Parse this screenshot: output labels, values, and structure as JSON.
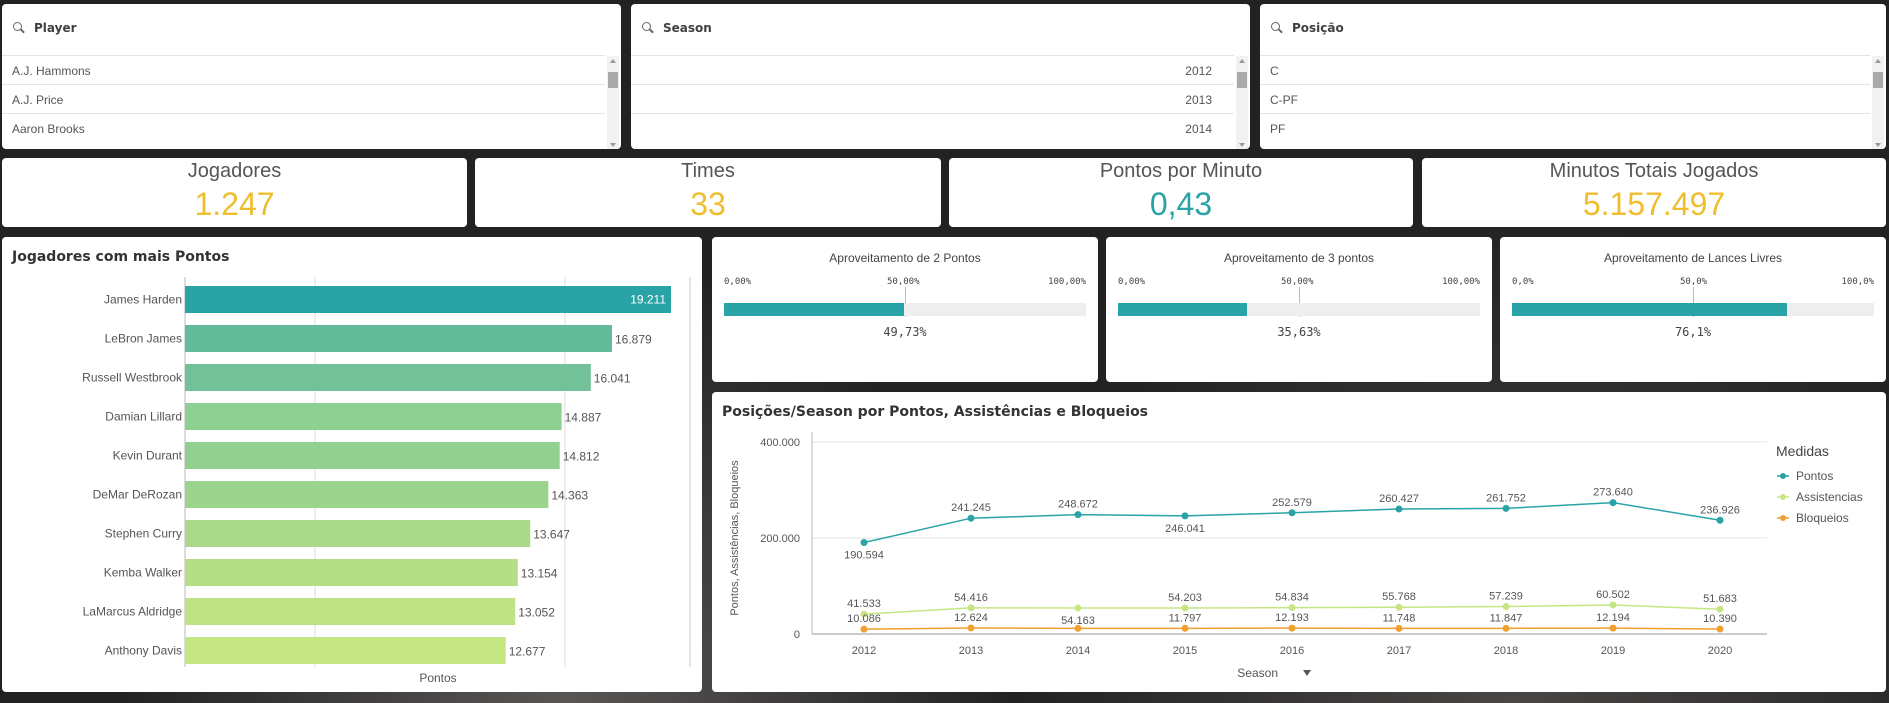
{
  "filters": [
    {
      "title": "Player",
      "items": [
        "A.J. Hammons",
        "A.J. Price",
        "Aaron Brooks"
      ],
      "align": "left"
    },
    {
      "title": "Season",
      "items": [
        "2012",
        "2013",
        "2014"
      ],
      "align": "right"
    },
    {
      "title": "Posição",
      "items": [
        "C",
        "C-PF",
        "PF"
      ],
      "align": "left"
    }
  ],
  "kpis": [
    {
      "label": "Jogadores",
      "value": "1.247",
      "color": "#f0be2d"
    },
    {
      "label": "Times",
      "value": "33",
      "color": "#f0be2d"
    },
    {
      "label": "Pontos por Minuto",
      "value": "0,43",
      "color": "#2aa3a6"
    },
    {
      "label": "Minutos Totais Jogados",
      "value": "5.157.497",
      "color": "#f0be2d"
    }
  ],
  "gauges": [
    {
      "title": "Aproveitamento de 2 Pontos",
      "ticks": [
        "0,00%",
        "50,00%",
        "100,00%"
      ],
      "fraction": 0.4973,
      "value_label": "49,73%"
    },
    {
      "title": "Aproveitamento de 3 pontos",
      "ticks": [
        "0,00%",
        "50,00%",
        "100,00%"
      ],
      "fraction": 0.3563,
      "value_label": "35,63%"
    },
    {
      "title": "Aproveitamento de Lances Livres",
      "ticks": [
        "0,0%",
        "50,0%",
        "100,0%"
      ],
      "fraction": 0.761,
      "value_label": "76,1%"
    }
  ],
  "chart_data": [
    {
      "type": "bar",
      "orientation": "horizontal",
      "title": "Jogadores com mais Pontos",
      "xlabel": "Pontos",
      "categories": [
        "James Harden",
        "LeBron James",
        "Russell Westbrook",
        "Damian Lillard",
        "Kevin Durant",
        "DeMar DeRozan",
        "Stephen Curry",
        "Kemba Walker",
        "LaMarcus Aldridge",
        "Anthony Davis"
      ],
      "values": [
        19211,
        16879,
        16041,
        14887,
        14812,
        14363,
        13647,
        13154,
        13052,
        12677
      ],
      "value_labels": [
        "19.211",
        "16.879",
        "16.041",
        "14.887",
        "14.812",
        "14.363",
        "13.647",
        "13.154",
        "13.052",
        "12.677"
      ],
      "colors": [
        "#2aa3a6",
        "#62bc9c",
        "#72c198",
        "#8ecf92",
        "#92d090",
        "#9dd48d",
        "#abd98a",
        "#b6de87",
        "#bfe285",
        "#c6e684"
      ],
      "xlim": [
        0,
        19211
      ],
      "grid": true
    },
    {
      "type": "line",
      "title": "Posições/Season por Pontos, Assistências e Bloqueios",
      "xlabel": "Season",
      "ylabel": "Pontos, Assistências, Bloqueios",
      "x": [
        "2012",
        "2013",
        "2014",
        "2015",
        "2016",
        "2017",
        "2018",
        "2019",
        "2020"
      ],
      "yticks": [
        "0",
        "200.000",
        "400.000"
      ],
      "ylim": [
        0,
        400000
      ],
      "legend_title": "Medidas",
      "legend_position": "right",
      "series": [
        {
          "name": "Pontos",
          "color": "#2aa3a6",
          "values": [
            190594,
            241245,
            248672,
            246041,
            252579,
            260427,
            261752,
            273640,
            236926
          ],
          "labels": [
            "190.594",
            "241.245",
            "248.672",
            "246.041",
            "252.579",
            "260.427",
            "261.752",
            "273.640",
            "236.926"
          ],
          "label_pos": [
            "below",
            "above",
            "above",
            "below",
            "above",
            "above",
            "above",
            "above",
            "above"
          ]
        },
        {
          "name": "Assistencias",
          "color": "#c6e684",
          "values": [
            41533,
            54416,
            54163,
            54203,
            54834,
            55768,
            57239,
            60502,
            51683
          ],
          "labels": [
            "41.533",
            "54.416",
            "54.163",
            "54.203",
            "54.834",
            "55.768",
            "57.239",
            "60.502",
            "51.683"
          ],
          "label_pos": [
            "above",
            "above",
            "below",
            "above",
            "above",
            "above",
            "above",
            "above",
            "above"
          ]
        },
        {
          "name": "Bloqueios",
          "color": "#f0a030",
          "values": [
            10086,
            12624,
            11797,
            11797,
            12193,
            11748,
            11847,
            12194,
            10390
          ],
          "labels": [
            "10.086",
            "12.624",
            "",
            "11.797",
            "12.193",
            "11.748",
            "11.847",
            "12.194",
            "10.390"
          ],
          "label_pos": [
            "above",
            "above",
            "above",
            "above",
            "above",
            "above",
            "above",
            "above",
            "above"
          ]
        }
      ]
    }
  ]
}
